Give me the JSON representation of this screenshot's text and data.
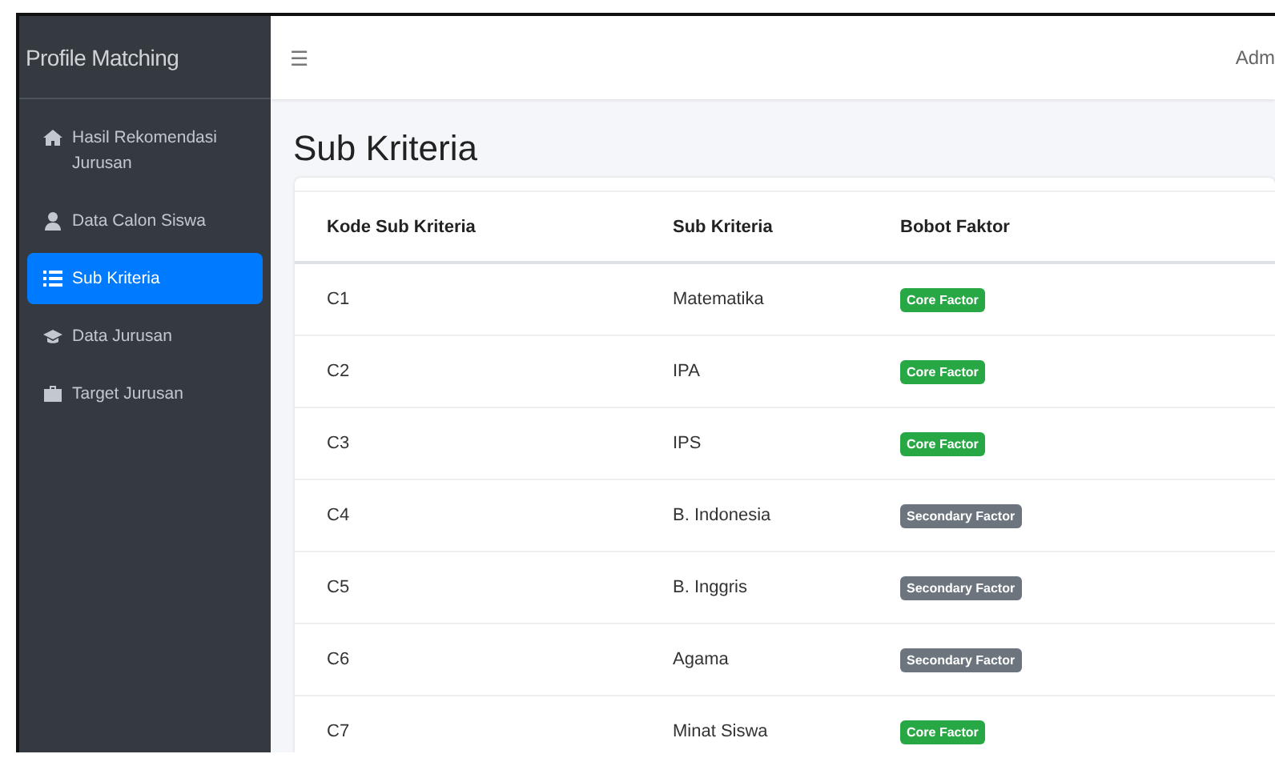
{
  "sidebar": {
    "brand": "Profile Matching",
    "items": [
      {
        "label": "Hasil Rekomendasi Jurusan",
        "selected": false
      },
      {
        "label": "Data Calon Siswa",
        "selected": false
      },
      {
        "label": "Sub Kriteria",
        "selected": true
      },
      {
        "label": "Data Jurusan",
        "selected": false
      },
      {
        "label": "Target Jurusan",
        "selected": false
      }
    ]
  },
  "navbar": {
    "menu_glyph": "☰",
    "user": "Adm"
  },
  "page_title": "Sub Kriteria",
  "table": {
    "columns": [
      "Kode Sub Kriteria",
      "Sub Kriteria",
      "Bobot Faktor"
    ],
    "rows": [
      {
        "code": "C1",
        "name": "Matematika",
        "factor": "Core Factor",
        "kind": "core"
      },
      {
        "code": "C2",
        "name": "IPA",
        "factor": "Core Factor",
        "kind": "core"
      },
      {
        "code": "C3",
        "name": "IPS",
        "factor": "Core Factor",
        "kind": "core"
      },
      {
        "code": "C4",
        "name": "B. Indonesia",
        "factor": "Secondary Factor",
        "kind": "secondary"
      },
      {
        "code": "C5",
        "name": "B. Inggris",
        "factor": "Secondary Factor",
        "kind": "secondary"
      },
      {
        "code": "C6",
        "name": "Agama",
        "factor": "Secondary Factor",
        "kind": "secondary"
      },
      {
        "code": "C7",
        "name": "Minat Siswa",
        "factor": "Core Factor",
        "kind": "core"
      }
    ]
  }
}
